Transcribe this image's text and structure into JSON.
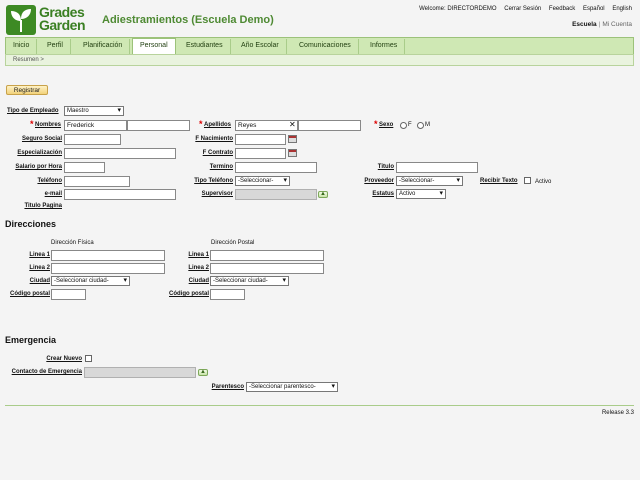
{
  "header": {
    "logo_line1": "Grades",
    "logo_line2": "Garden",
    "title": "Adiestramientos (Escuela Demo)",
    "welcome": "Welcome: DIRECTORDEMO",
    "links": [
      "Cerrar Sesión",
      "Feedback",
      "Español",
      "English"
    ],
    "context_current": "Escuela",
    "context_other": "Mi Cuenta"
  },
  "nav": {
    "tabs": [
      "Inicio",
      "Perfil",
      "Planificación",
      "Personal",
      "Estudiantes",
      "Año Escolar",
      "Comunicaciones",
      "Informes"
    ],
    "active": "Personal",
    "breadcrumb": "Resumen >"
  },
  "actions": {
    "register_label": "Registrar"
  },
  "form": {
    "tipo_empleado": {
      "label": "Tipo de Empleado",
      "value": "Maestro"
    },
    "nombres": {
      "label": "Nombres",
      "value": "Frederick",
      "second": ""
    },
    "apellidos": {
      "label": "Apellidos",
      "value": "Reyes",
      "second": ""
    },
    "sexo": {
      "label": "Sexo",
      "options": [
        "F",
        "M"
      ]
    },
    "seguro_social": {
      "label": "Seguro Social",
      "value": ""
    },
    "f_nacimiento": {
      "label": "F Nacimiento",
      "value": ""
    },
    "especializacion": {
      "label": "Especialización",
      "value": ""
    },
    "f_contrato": {
      "label": "F Contrato",
      "value": ""
    },
    "salario": {
      "label": "Salario por Hora",
      "value": ""
    },
    "termino": {
      "label": "Termino",
      "value": ""
    },
    "titulo": {
      "label": "Titulo",
      "value": ""
    },
    "telefono": {
      "label": "Teléfono",
      "value": ""
    },
    "tipo_telefono": {
      "label": "Tipo Teléfono",
      "value": "-Seleccionar-"
    },
    "proveedor": {
      "label": "Proveedor",
      "value": "-Seleccionar-"
    },
    "recibir_texto": {
      "label": "Recibir Texto",
      "option": "Activo"
    },
    "email": {
      "label": "e-mail",
      "value": ""
    },
    "supervisor": {
      "label": "Supervisor",
      "value": ""
    },
    "estatus": {
      "label": "Estatus",
      "value": "Activo"
    },
    "titulo_pagina": {
      "label": "Titulo Pagina"
    }
  },
  "direcciones": {
    "title": "Direcciones",
    "fisica_header": "Dirección Física",
    "postal_header": "Dirección Postal",
    "linea1": "Linea 1",
    "linea2": "Linea 2",
    "ciudad": "Ciudad",
    "ciudad_placeholder": "-Seleccionar ciudad-",
    "codigo_postal": "Código postal"
  },
  "emergencia": {
    "title": "Emergencia",
    "crear_nuevo": "Crear Nuevo",
    "contacto": "Contacto de Emergencia",
    "parentesco": "Parentesco",
    "parentesco_value": "-Seleccionar parentesco-"
  },
  "footer": {
    "release": "Release 3.3"
  },
  "colors": {
    "brand_green": "#3d8a24",
    "nav_bg": "#cfe8b4",
    "button_gold": "#f2d27a",
    "required_red": "#dd0000"
  }
}
